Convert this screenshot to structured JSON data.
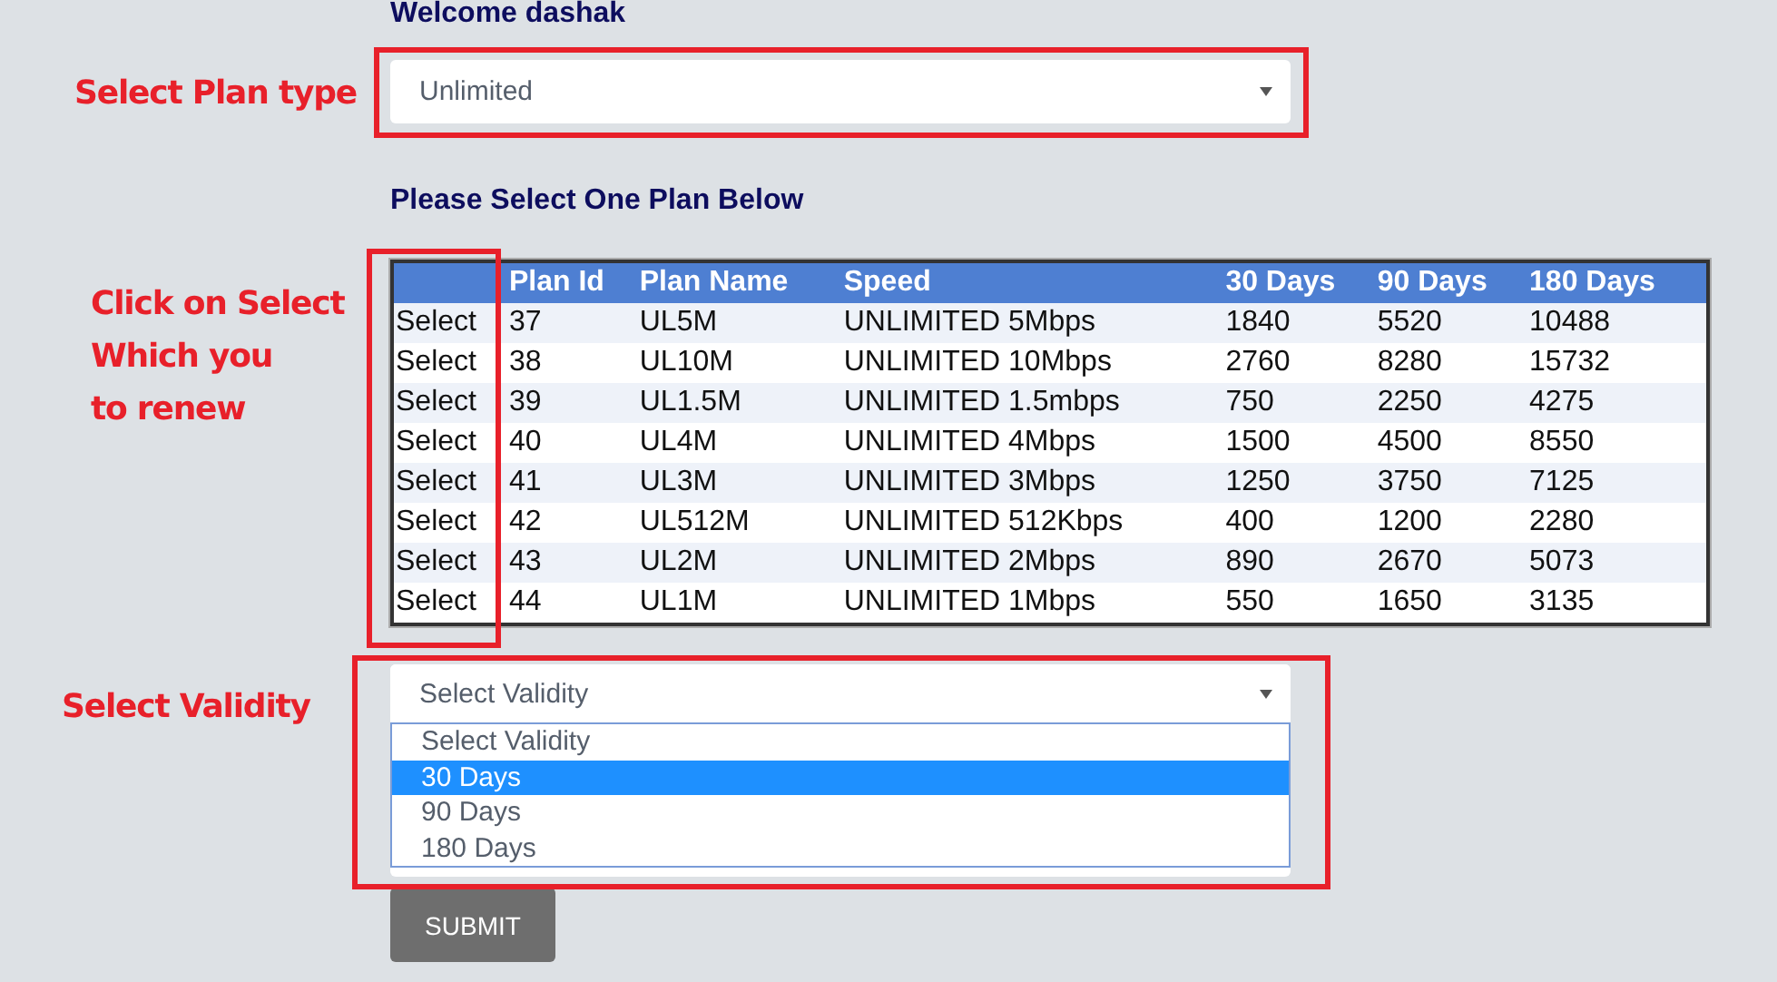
{
  "welcome": "Welcome dashak",
  "plan_type": {
    "value": "Unlimited"
  },
  "plans_heading": "Please Select One Plan Below",
  "table": {
    "columns": [
      "",
      "Plan Id",
      "Plan Name",
      "Speed",
      "30 Days",
      "90 Days",
      "180 Days"
    ],
    "rows": [
      [
        "Select",
        "37",
        "UL5M",
        "UNLIMITED 5Mbps",
        "1840",
        "5520",
        "10488"
      ],
      [
        "Select",
        "38",
        "UL10M",
        "UNLIMITED 10Mbps",
        "2760",
        "8280",
        "15732"
      ],
      [
        "Select",
        "39",
        "UL1.5M",
        "UNLIMITED 1.5mbps",
        "750",
        "2250",
        "4275"
      ],
      [
        "Select",
        "40",
        "UL4M",
        "UNLIMITED 4Mbps",
        "1500",
        "4500",
        "8550"
      ],
      [
        "Select",
        "41",
        "UL3M",
        "UNLIMITED 3Mbps",
        "1250",
        "3750",
        "7125"
      ],
      [
        "Select",
        "42",
        "UL512M",
        "UNLIMITED 512Kbps",
        "400",
        "1200",
        "2280"
      ],
      [
        "Select",
        "43",
        "UL2M",
        "UNLIMITED 2Mbps",
        "890",
        "2670",
        "5073"
      ],
      [
        "Select",
        "44",
        "UL1M",
        "UNLIMITED 1Mbps",
        "550",
        "1650",
        "3135"
      ]
    ]
  },
  "validity": {
    "value": "Select Validity",
    "expanded": true,
    "options": [
      {
        "label": "Select Validity",
        "highlighted": false
      },
      {
        "label": "30 Days",
        "highlighted": true
      },
      {
        "label": "90 Days",
        "highlighted": false
      },
      {
        "label": "180 Days",
        "highlighted": false
      }
    ]
  },
  "submit": "SUBMIT",
  "annotations": [
    "Select Plan type",
    "Click on Select\nWhich you\nto renew",
    "Select Validity"
  ]
}
